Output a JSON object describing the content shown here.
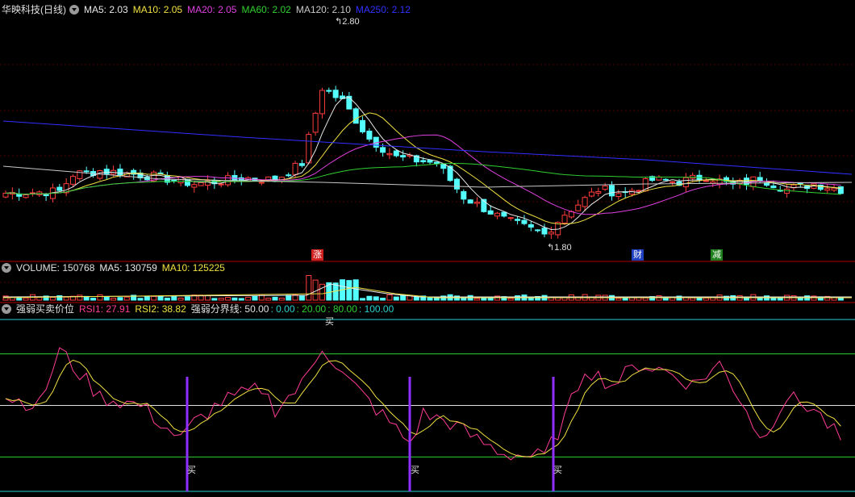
{
  "main_header": {
    "title": "华映科技(日线)",
    "ma": [
      {
        "label": "MA5: 2.03",
        "color": "#e8e8e8"
      },
      {
        "label": "MA10: 2.05",
        "color": "#f0e040"
      },
      {
        "label": "MA20: 2.05",
        "color": "#e040e0"
      },
      {
        "label": "MA60: 2.02",
        "color": "#30d030"
      },
      {
        "label": "MA120: 2.10",
        "color": "#c8c8c8"
      },
      {
        "label": "MA250: 2.12",
        "color": "#3030ff"
      }
    ]
  },
  "price_labels": {
    "high": "2.80",
    "low": "1.80"
  },
  "event_markers": {
    "zhang": "涨",
    "cai": "财",
    "jian": "减"
  },
  "volume_header": {
    "title": "VOLUME: 150768",
    "ma5": "MA5: 130759",
    "ma10": "MA10: 125225"
  },
  "rsi_header": {
    "title": "强弱买卖价位",
    "rsi1": "RSI1: 27.91",
    "rsi2": "RSI2: 38.82",
    "line_label": "强弱分界线: 50.00",
    "levels": [
      ": 0.00",
      ": 20.00",
      ": 80.00",
      ": 100.00"
    ]
  },
  "signals": {
    "buy": "买"
  },
  "colors": {
    "up": "#ff3c3c",
    "down": "#54ffff",
    "ma5": "#e8e8e8",
    "ma10": "#f0e040",
    "ma20": "#e040e0",
    "ma60": "#30d030",
    "ma120": "#c8c8c8",
    "ma250": "#3030ff",
    "rsi1": "#ff3c96",
    "rsi2": "#f0e040",
    "buy_line": "#9030ff",
    "separator": "#b00000"
  },
  "chart_data": {
    "type": "candlestick",
    "series_ma": {
      "MA5": 2.03,
      "MA10": 2.05,
      "MA20": 2.05,
      "MA60": 2.02,
      "MA120": 2.1,
      "MA250": 2.12
    },
    "price_high": 2.8,
    "price_low": 1.8,
    "volume": 150768,
    "volume_ma5": 130759,
    "volume_ma10": 125225,
    "rsi1": 27.91,
    "rsi2": 38.82,
    "rsi_levels": [
      0,
      20,
      50,
      80,
      100
    ]
  }
}
